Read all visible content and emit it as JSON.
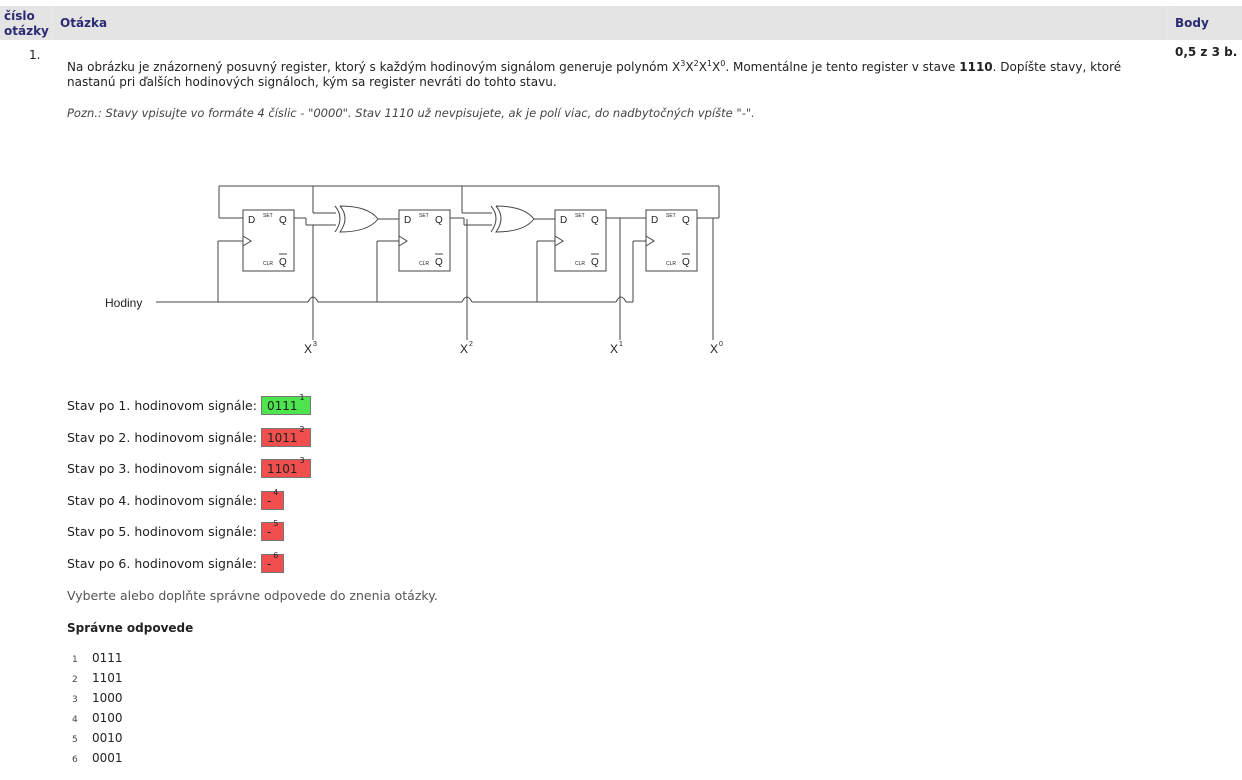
{
  "table": {
    "col_number": "číslo otázky",
    "col_question": "Otázka",
    "col_points": "Body"
  },
  "question": {
    "number": "1.",
    "points": "0,5 z 3 b.",
    "text_part1": "Na obrázku je znázornený posuvný register, ktorý s každým hodinovým signálom generuje polynóm ",
    "text_part2": ". Momentálne je tento register v stave ",
    "state": "1110",
    "text_part3": ". Dopíšte stavy, ktoré nastanú pri ďalších hodinových signáloch, kým sa register nevráti do tohto stavu.",
    "note": "Pozn.: Stavy vpisujte vo formáte 4 číslic - \"0000\". Stav 1110 už nevpisujete, ak je polí viac, do nadbytočných vpíšte \"-\"."
  },
  "circuit": {
    "clock_label": "Hodiny",
    "ff_d": "D",
    "ff_q": "Q",
    "ff_set": "SET",
    "ff_clr": "CLR",
    "outputs": [
      "X",
      "X",
      "X",
      "X"
    ],
    "exponents": [
      "3",
      "2",
      "1",
      "0"
    ]
  },
  "answers": [
    {
      "label": "Stav po 1. hodinovom signále:",
      "value": "0111",
      "index": "1",
      "status": "correct",
      "color": "#4de44d"
    },
    {
      "label": "Stav po 2. hodinovom signále:",
      "value": "1011",
      "index": "2",
      "status": "wrong",
      "color": "#f14e4e"
    },
    {
      "label": "Stav po 3. hodinovom signále:",
      "value": "1101",
      "index": "3",
      "status": "wrong",
      "color": "#f14e4e"
    },
    {
      "label": "Stav po 4. hodinovom signále:",
      "value": "-",
      "index": "4",
      "status": "wrong",
      "color": "#f14e4e"
    },
    {
      "label": "Stav po 5. hodinovom signále:",
      "value": "-",
      "index": "5",
      "status": "wrong",
      "color": "#f14e4e"
    },
    {
      "label": "Stav po 6. hodinovom signále:",
      "value": "-",
      "index": "6",
      "status": "wrong",
      "color": "#f14e4e"
    }
  ],
  "instructions": "Vyberte alebo doplňte správne odpovede do znenia otázky.",
  "correct_heading": "Správne odpovede",
  "correct_answers": [
    {
      "n": "1",
      "value": "0111"
    },
    {
      "n": "2",
      "value": "1101"
    },
    {
      "n": "3",
      "value": "1000"
    },
    {
      "n": "4",
      "value": "0100"
    },
    {
      "n": "5",
      "value": "0010"
    },
    {
      "n": "6",
      "value": "0001"
    }
  ]
}
